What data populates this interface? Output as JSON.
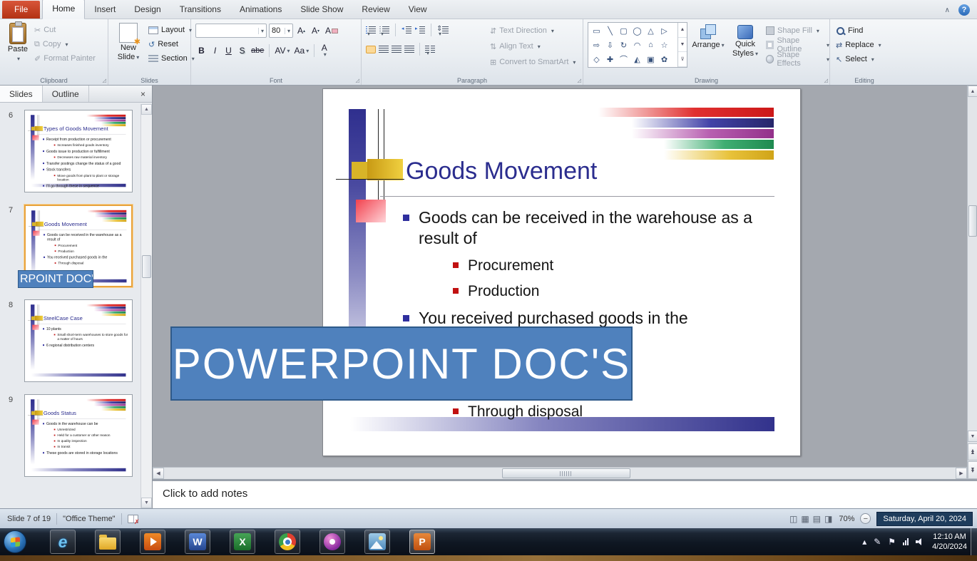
{
  "window": {
    "minimize_ribbon": "∧",
    "help": "?"
  },
  "ribbon": {
    "tabs": [
      {
        "label": "File",
        "type": "file"
      },
      {
        "label": "Home",
        "active": true
      },
      {
        "label": "Insert"
      },
      {
        "label": "Design"
      },
      {
        "label": "Transitions"
      },
      {
        "label": "Animations"
      },
      {
        "label": "Slide Show"
      },
      {
        "label": "Review"
      },
      {
        "label": "View"
      }
    ],
    "clipboard": {
      "label": "Clipboard",
      "paste": "Paste",
      "cut": "Cut",
      "copy": "Copy",
      "format_painter": "Format Painter"
    },
    "slides_group": {
      "label": "Slides",
      "new_line1": "New",
      "new_line2": "Slide",
      "layout": "Layout",
      "reset": "Reset",
      "section": "Section"
    },
    "font_group": {
      "label": "Font",
      "font_name": "",
      "font_size": "80",
      "bold": "B",
      "italic": "I",
      "underline": "U",
      "shadow": "S",
      "strikethrough": "abe",
      "char_spacing": "AV",
      "change_case": "Aa",
      "font_color": "A"
    },
    "paragraph_group": {
      "label": "Paragraph",
      "text_direction": "Text Direction",
      "align_text": "Align Text",
      "smartart": "Convert to SmartArt"
    },
    "drawing_group": {
      "label": "Drawing",
      "arrange": "Arrange",
      "quick1": "Quick",
      "quick2": "Styles",
      "shape_fill": "Shape Fill",
      "shape_outline": "Shape Outline",
      "shape_effects": "Shape Effects"
    },
    "editing_group": {
      "label": "Editing",
      "find": "Find",
      "replace": "Replace",
      "select": "Select"
    }
  },
  "icons": {
    "dropdown": "▾",
    "scissors": "✂",
    "copy": "⧉",
    "format_painter_brush": "✐",
    "dialog_launcher": "◿",
    "scroll_up": "▲",
    "scroll_down": "▼",
    "shapes_rows": [
      [
        "▭",
        "╲",
        "▢",
        "◯",
        "△",
        "▷"
      ],
      [
        "⇨",
        "⇩",
        "↻",
        "◠",
        "⌂",
        "☆"
      ],
      [
        "◇",
        "✚",
        "⌒",
        "◭",
        "▣",
        "✿"
      ]
    ],
    "view_buttons": [
      "◫",
      "▦",
      "▤",
      "◨"
    ]
  },
  "panel": {
    "tabs": [
      {
        "label": "Slides",
        "active": true
      },
      {
        "label": "Outline",
        "active": false
      }
    ],
    "close": "×",
    "thumbnails": [
      {
        "number": "6",
        "selected": false,
        "slide": {
          "title": "Types of Goods Movement",
          "bullets": [
            {
              "text": "Receipt from production or procurement",
              "level": 1
            },
            {
              "text": "Increases finished goods inventory",
              "level": 2
            },
            {
              "text": "Goods issue to production or fulfillment",
              "level": 1
            },
            {
              "text": "Decreases raw material inventory",
              "level": 2
            },
            {
              "text": "Transfer postings change the status of a good",
              "level": 1
            },
            {
              "text": "Stock transfers",
              "level": 1
            },
            {
              "text": "Move goods from plant to plant or storage location",
              "level": 2
            },
            {
              "text": "I'll go through these in sequence",
              "level": 1
            }
          ]
        }
      },
      {
        "number": "7",
        "selected": true,
        "slide": {
          "title": "Goods Movement",
          "bullets": [
            {
              "text": "Goods can be received in the warehouse as a result of",
              "level": 1
            },
            {
              "text": "Procurement",
              "level": 2
            },
            {
              "text": "Production",
              "level": 2
            },
            {
              "text": "You received purchased goods in the",
              "level": 1
            },
            {
              "text": "Through disposal",
              "level": 2
            }
          ]
        }
      },
      {
        "number": "8",
        "selected": false,
        "slide": {
          "title": "SteelCase Case",
          "bullets": [
            {
              "text": "10 plants",
              "level": 1
            },
            {
              "text": "Small short-term warehouses to store goods for a matter of hours",
              "level": 2
            },
            {
              "text": "6 regional distribution centers",
              "level": 1
            }
          ]
        }
      },
      {
        "number": "9",
        "selected": false,
        "slide": {
          "title": "Goods Status",
          "bullets": [
            {
              "text": "Goods in the warehouse can be",
              "level": 1
            },
            {
              "text": "Unrestricted",
              "level": 2
            },
            {
              "text": "Held for a customer or other reason",
              "level": 2
            },
            {
              "text": "In quality inspection",
              "level": 2
            },
            {
              "text": "In transit",
              "level": 2
            },
            {
              "text": "These goods are stored in storage locations",
              "level": 1
            }
          ]
        }
      }
    ]
  },
  "slide": {
    "title": "Goods Movement",
    "bullets": [
      {
        "text": "Goods can be received in the warehouse as a result of",
        "level": 1
      },
      {
        "text": "Procurement",
        "level": 2
      },
      {
        "text": "Production",
        "level": 2
      },
      {
        "text": "You received purchased goods in the",
        "level": 1
      },
      {
        "text": "Through disposal",
        "level": 2
      }
    ]
  },
  "watermark": {
    "big": "POWERPOINT DOC'S",
    "small": "RPOINT DOC'S"
  },
  "notes": {
    "placeholder": "Click to add notes"
  },
  "status": {
    "slide_indicator": "Slide 7 of 19",
    "theme": "\"Office Theme\"",
    "zoom": "70%",
    "date": "Saturday, April 20, 2024"
  },
  "taskbar": {
    "app_letters": {
      "ie": "e",
      "word": "W",
      "excel": "X",
      "powerpoint": "P"
    },
    "time": "12:10 AM",
    "date": "4/20/2024"
  },
  "colors": {
    "accent_blue": "#4f81bd",
    "selected_thumb_border": "#e8a33d",
    "file_tab_red": "#c0391b",
    "slide_title_blue": "#2b2d8e"
  }
}
